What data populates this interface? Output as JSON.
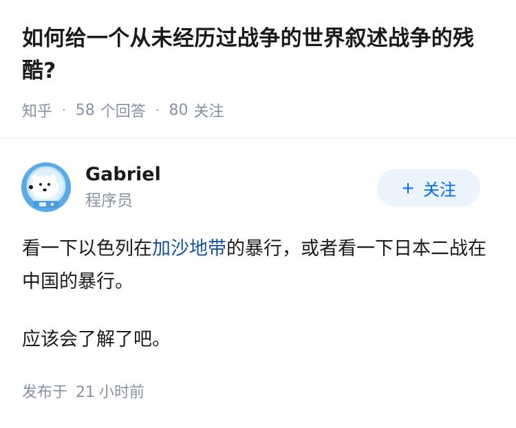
{
  "question": {
    "title": "如何给一个从未经历过战争的世界叙述战争的残酷?",
    "source": "知乎",
    "separator": "·",
    "answers_count": "58",
    "answers_label": "个回答",
    "followers_count": "80",
    "followers_label": "关注"
  },
  "author": {
    "name": "Gabriel",
    "bio": "程序员",
    "avatar_icon": "polar-bear-astronaut-avatar",
    "follow_label": "关注",
    "follow_prefix": "+"
  },
  "answer": {
    "paragraph_1_before": "看一下以色列在",
    "paragraph_1_link": "加沙地带",
    "paragraph_1_after": "的暴行，或者看一下日本二战在中国的暴行。",
    "paragraph_2": "应该会了解了吧。",
    "published_label": "发布于",
    "published_value": "21",
    "published_unit": "小时前"
  },
  "colors": {
    "title": "#1a1a1a",
    "meta": "#8590a6",
    "link": "#175199",
    "follow_bg": "#ebf3ff",
    "follow_text": "#0066ff",
    "divider": "#ececec"
  }
}
